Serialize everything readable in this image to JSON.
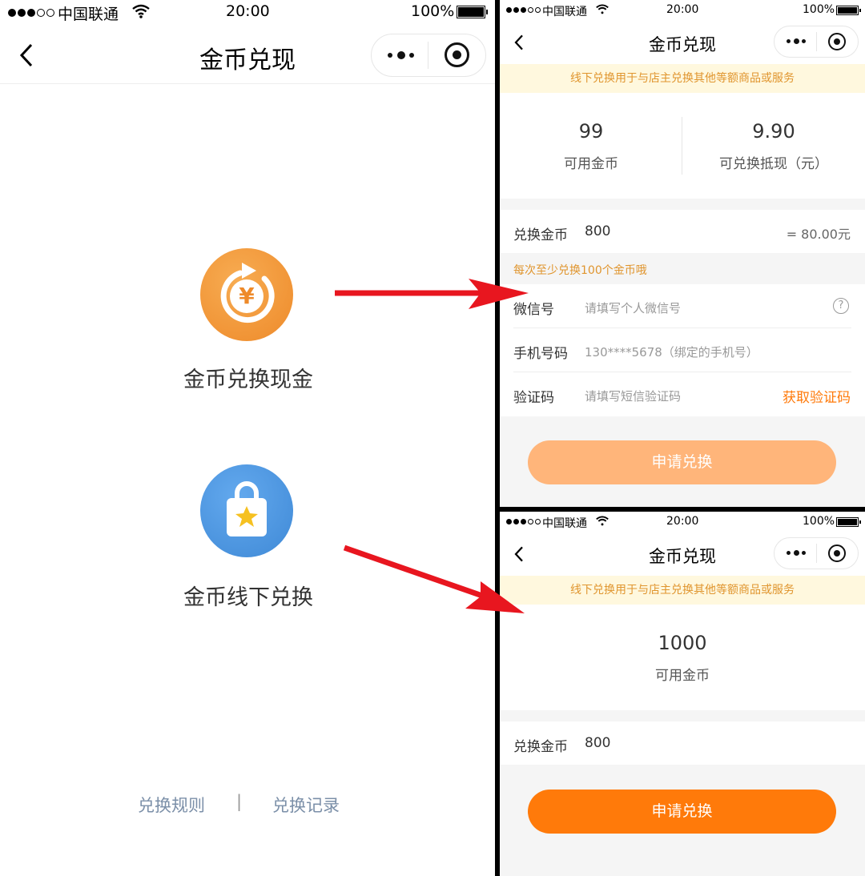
{
  "status_bar": {
    "carrier": "中国联通",
    "time": "20:00",
    "battery": "100%"
  },
  "nav": {
    "title": "金币兑现"
  },
  "home": {
    "option_cash": "金币兑换现金",
    "option_offline": "金币线下兑换",
    "cash_symbol": "¥",
    "footer": {
      "rules": "兑换规则",
      "divider": "|",
      "records": "兑换记录"
    }
  },
  "cash_page": {
    "notice": "线下兑换用于与店主兑换其他等额商品或服务",
    "stats": [
      {
        "value": "99",
        "label": "可用金币"
      },
      {
        "value": "9.90",
        "label": "可兑换抵现（元）"
      }
    ],
    "exchange": {
      "label": "兑换金币",
      "value": "800",
      "equals": "= 80.00元"
    },
    "hint": "每次至少兑换100个金币哦",
    "fields": [
      {
        "label": "微信号",
        "placeholder": "请填写个人微信号"
      },
      {
        "label": "手机号码",
        "value": "130****5678（绑定的手机号）"
      },
      {
        "label": "验证码",
        "placeholder": "请填写短信验证码",
        "action": "获取验证码"
      }
    ],
    "submit": "申请兑换"
  },
  "offline_page": {
    "notice": "线下兑换用于与店主兑换其他等额商品或服务",
    "balance": {
      "value": "1000",
      "label": "可用金币"
    },
    "exchange": {
      "label": "兑换金币",
      "value": "800"
    },
    "submit": "申请兑换"
  },
  "colors": {
    "accent_orange": "#ff7a0a",
    "disabled_orange": "#ffb57a",
    "notice_bg": "#fff8de",
    "notice_text": "#e0952e",
    "link_blue": "#7b8fa8",
    "arrow_red": "#e8161f",
    "cash_icon_bg": "#f39a3c",
    "offline_icon_bg": "#4f97e0"
  },
  "icons": [
    "back-arrow-icon",
    "more-dots-icon",
    "target-circle-icon",
    "wifi-icon",
    "battery-icon",
    "coin-exchange-icon",
    "shopping-bag-star-icon",
    "question-icon",
    "red-arrow-icon"
  ]
}
